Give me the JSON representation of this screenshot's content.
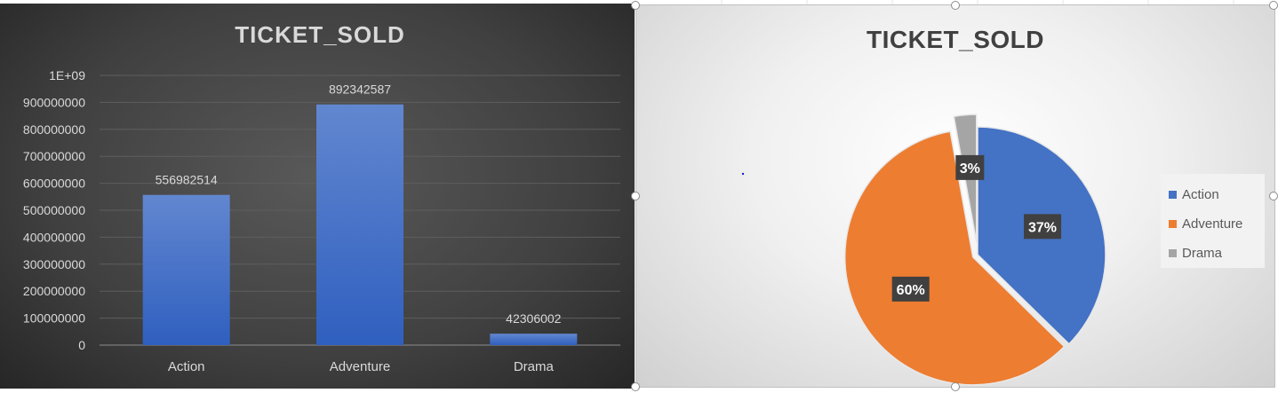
{
  "chart_data": [
    {
      "type": "bar",
      "title": "TICKET_SOLD",
      "categories": [
        "Action",
        "Adventure",
        "Drama"
      ],
      "values": [
        556982514,
        892342587,
        42306002
      ],
      "data_labels": [
        "556982514",
        "892342587",
        "42306002"
      ],
      "ylim": [
        0,
        1000000000
      ],
      "yticks": [
        0,
        100000000,
        200000000,
        300000000,
        400000000,
        500000000,
        600000000,
        700000000,
        800000000,
        900000000,
        1000000000
      ],
      "ytick_labels": [
        "0",
        "100000000",
        "200000000",
        "300000000",
        "400000000",
        "500000000",
        "600000000",
        "700000000",
        "800000000",
        "900000000",
        "1E+09"
      ],
      "grid": true,
      "colors": {
        "bar": "#4472C4",
        "background": "#404040",
        "text": "#d9d9d9"
      }
    },
    {
      "type": "pie",
      "title": "TICKET_SOLD",
      "categories": [
        "Action",
        "Adventure",
        "Drama"
      ],
      "values": [
        556982514,
        892342587,
        42306002
      ],
      "data_labels": [
        "37%",
        "60%",
        "3%"
      ],
      "legend": {
        "position": "right",
        "items": [
          "Action",
          "Adventure",
          "Drama"
        ]
      },
      "colors": [
        "#4472C4",
        "#ED7D31",
        "#A5A5A5"
      ]
    }
  ]
}
